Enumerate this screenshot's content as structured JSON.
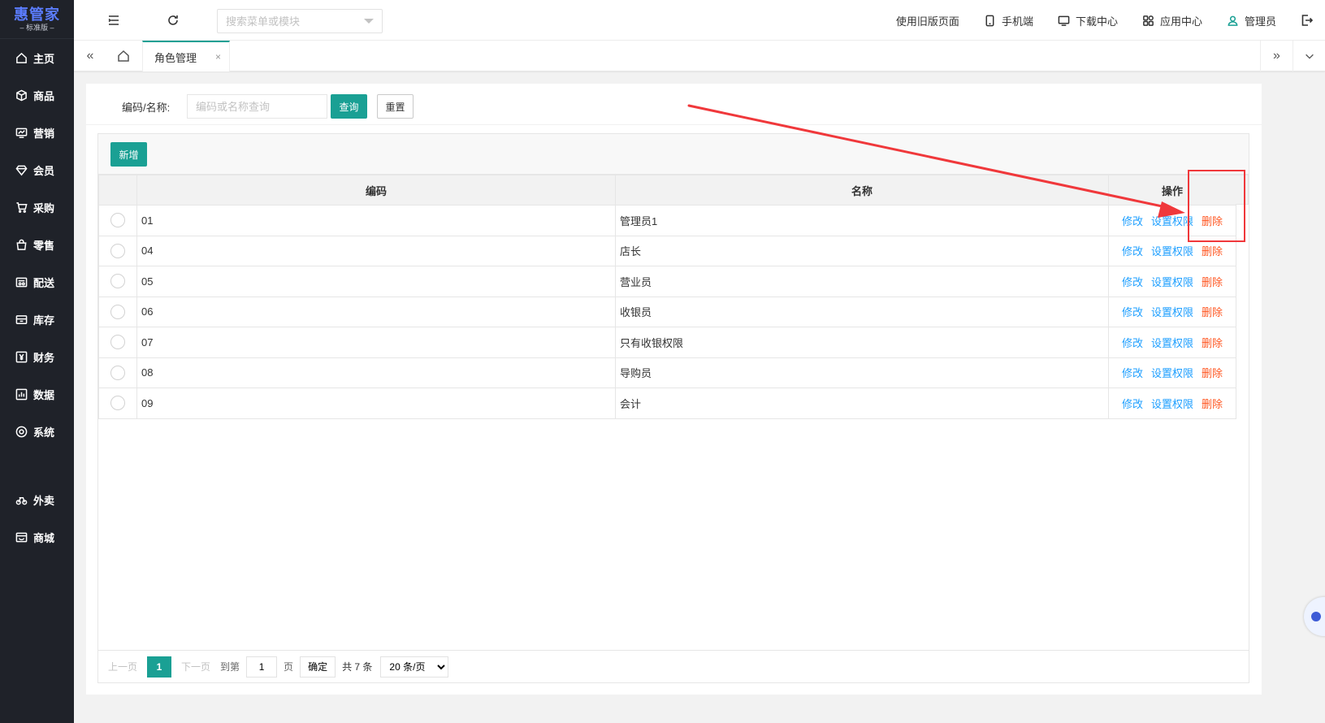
{
  "brand": {
    "name": "惠管家",
    "edition": "– 标准版 –"
  },
  "sidebar": {
    "items": [
      {
        "label": "主页",
        "icon": "home-icon"
      },
      {
        "label": "商品",
        "icon": "box-icon"
      },
      {
        "label": "营销",
        "icon": "chart-board-icon"
      },
      {
        "label": "会员",
        "icon": "diamond-icon"
      },
      {
        "label": "采购",
        "icon": "cart-icon"
      },
      {
        "label": "零售",
        "icon": "bag-icon"
      },
      {
        "label": "配送",
        "icon": "delivery-icon"
      },
      {
        "label": "库存",
        "icon": "warehouse-icon"
      },
      {
        "label": "财务",
        "icon": "yen-icon"
      },
      {
        "label": "数据",
        "icon": "bar-chart-icon"
      },
      {
        "label": "系统",
        "icon": "settings-ring-icon"
      }
    ],
    "extra_items": [
      {
        "label": "外卖",
        "icon": "bike-icon"
      },
      {
        "label": "商城",
        "icon": "store-icon"
      }
    ]
  },
  "topbar": {
    "search_placeholder": "搜索菜单或模块",
    "links": {
      "old_page": "使用旧版页面",
      "mobile": "手机端",
      "download": "下载中心",
      "apps": "应用中心",
      "user": "管理员"
    }
  },
  "tabs": {
    "active": "角色管理",
    "close": "×"
  },
  "filter": {
    "label": "编码/名称:",
    "placeholder": "编码或名称查询",
    "query_button": "查询",
    "reset_button": "重置"
  },
  "toolbar": {
    "add_button": "新增"
  },
  "table": {
    "columns": {
      "code": "编码",
      "name": "名称",
      "ops": "操作"
    },
    "ops_labels": {
      "edit": "修改",
      "permission": "设置权限",
      "delete": "删除"
    },
    "rows": [
      {
        "code": "01",
        "name": "管理员1"
      },
      {
        "code": "04",
        "name": "店长"
      },
      {
        "code": "05",
        "name": "营业员"
      },
      {
        "code": "06",
        "name": "收银员"
      },
      {
        "code": "07",
        "name": "只有收银权限"
      },
      {
        "code": "08",
        "name": "导购员"
      },
      {
        "code": "09",
        "name": "会计"
      }
    ]
  },
  "pager": {
    "prev": "上一页",
    "current": "1",
    "next": "下一页",
    "goto_label": "到第",
    "goto_value": "1",
    "page_unit": "页",
    "confirm": "确定",
    "total": "共 7 条",
    "page_size": "20 条/页",
    "page_size_options": [
      "20 条/页"
    ]
  },
  "colors": {
    "sidebar_bg": "#1f2229",
    "accent": "#1aa094",
    "link": "#1e9fff",
    "danger": "#ff5722",
    "annotation": "#f0383b"
  }
}
